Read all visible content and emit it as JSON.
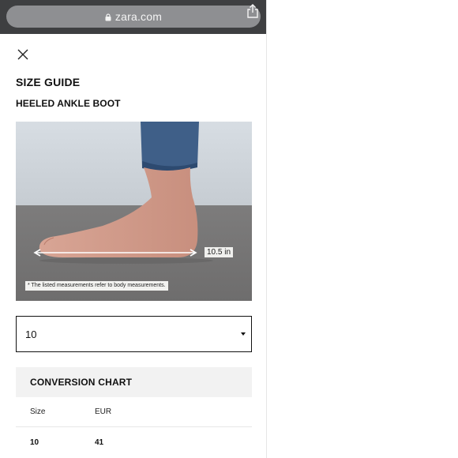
{
  "browser": {
    "url": "zara.com",
    "icons": [
      "lock-icon",
      "share-icon"
    ]
  },
  "modal": {
    "close_icon": "close-icon",
    "title": "SIZE GUIDE",
    "product": "HEELED ANKLE BOOT"
  },
  "photo": {
    "measurement": "10.5 in",
    "note": "* The listed measurements refer to body measurements."
  },
  "size_select": {
    "selected": "10",
    "icon": "chevron-down-icon"
  },
  "conversion": {
    "title": "CONVERSION CHART",
    "columns": [
      "Size",
      "EUR"
    ],
    "rows": [
      [
        "10",
        "41"
      ]
    ]
  }
}
